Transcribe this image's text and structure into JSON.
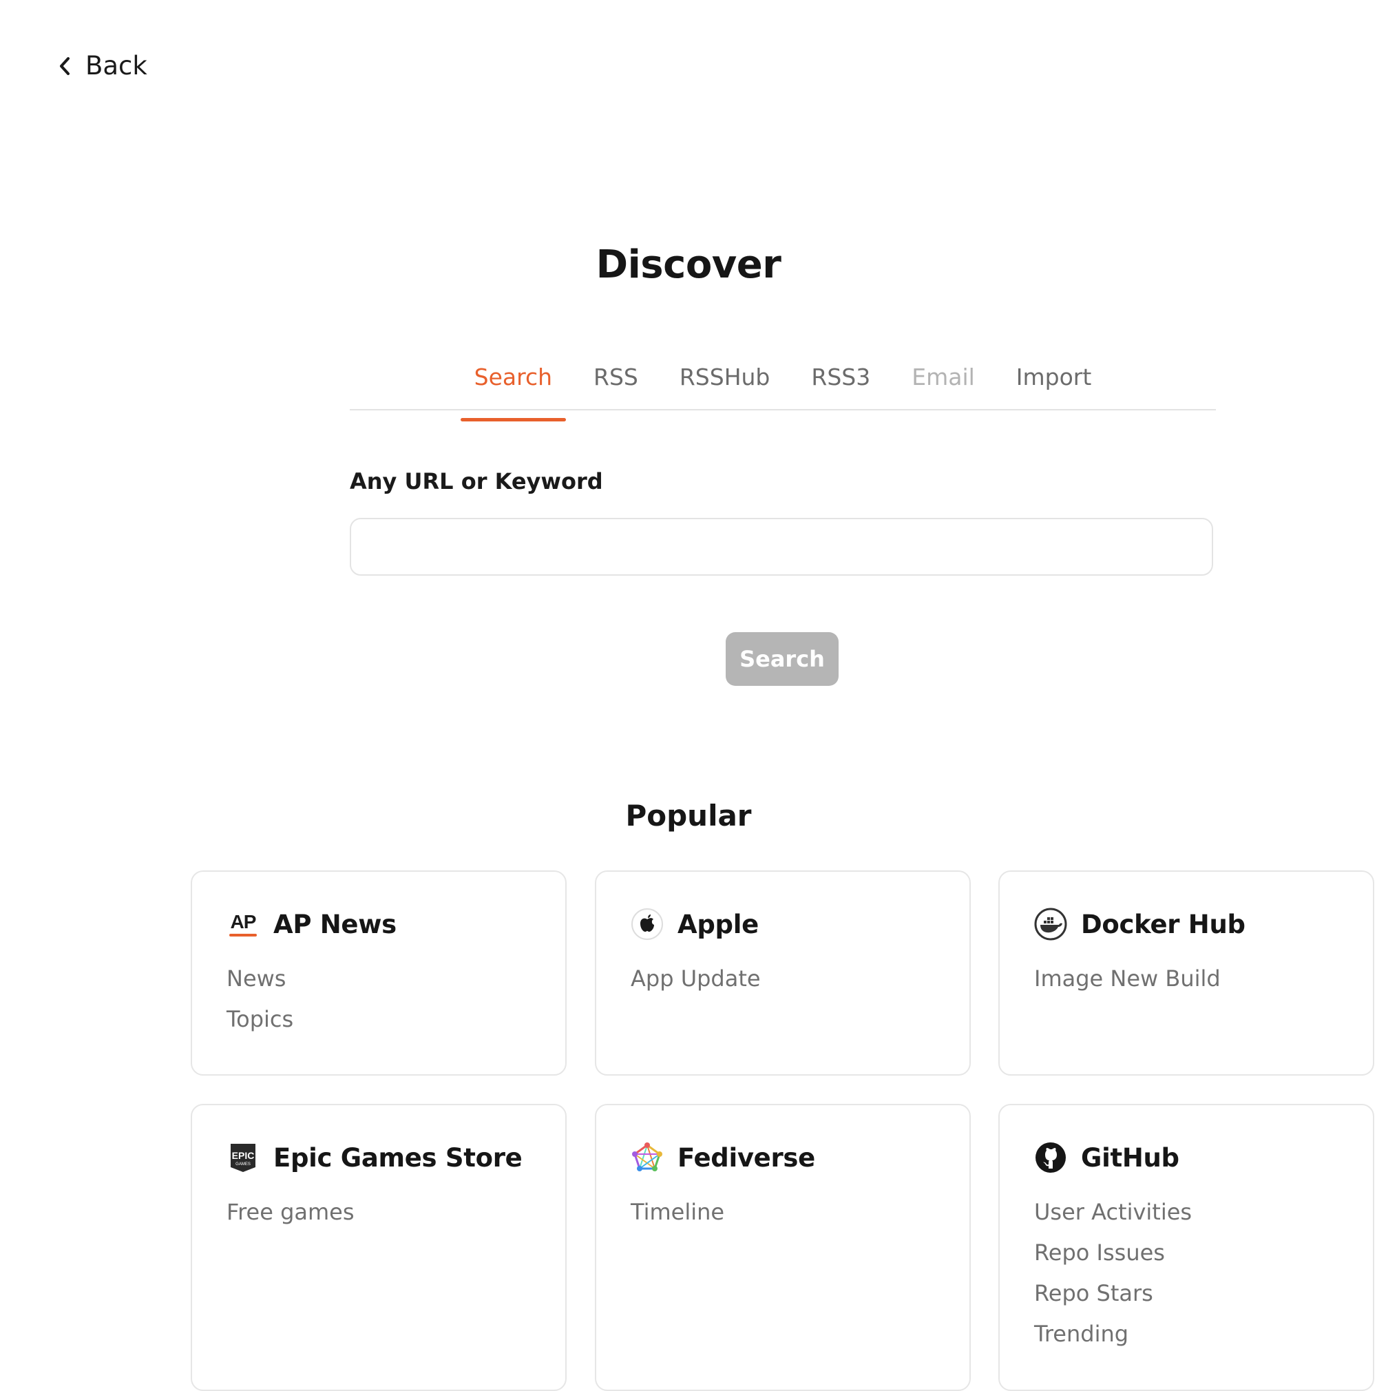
{
  "nav": {
    "back_label": "Back"
  },
  "page": {
    "title": "Discover"
  },
  "tabs": [
    {
      "label": "Search",
      "state": "active"
    },
    {
      "label": "RSS",
      "state": "normal"
    },
    {
      "label": "RSSHub",
      "state": "normal"
    },
    {
      "label": "RSS3",
      "state": "normal"
    },
    {
      "label": "Email",
      "state": "disabled"
    },
    {
      "label": "Import",
      "state": "normal"
    }
  ],
  "search": {
    "field_label": "Any URL or Keyword",
    "value": "",
    "placeholder": "",
    "button_label": "Search"
  },
  "popular": {
    "title": "Popular",
    "cards": [
      {
        "title": "AP News",
        "icon": "ap-news-logo-icon",
        "items": [
          "News",
          "Topics"
        ]
      },
      {
        "title": "Apple",
        "icon": "apple-logo-icon",
        "items": [
          "App Update"
        ]
      },
      {
        "title": "Docker Hub",
        "icon": "docker-logo-icon",
        "items": [
          "Image New Build"
        ]
      },
      {
        "title": "Epic Games Store",
        "icon": "epic-games-logo-icon",
        "items": [
          "Free games"
        ]
      },
      {
        "title": "Fediverse",
        "icon": "fediverse-logo-icon",
        "items": [
          "Timeline"
        ]
      },
      {
        "title": "GitHub",
        "icon": "github-logo-icon",
        "items": [
          "User Activities",
          "Repo Issues",
          "Repo Stars",
          "Trending"
        ]
      }
    ]
  },
  "colors": {
    "accent": "#e8602c",
    "tab_inactive": "#6b6b6b",
    "tab_disabled": "#b3b3b3",
    "button_disabled": "#b5b5b5"
  }
}
